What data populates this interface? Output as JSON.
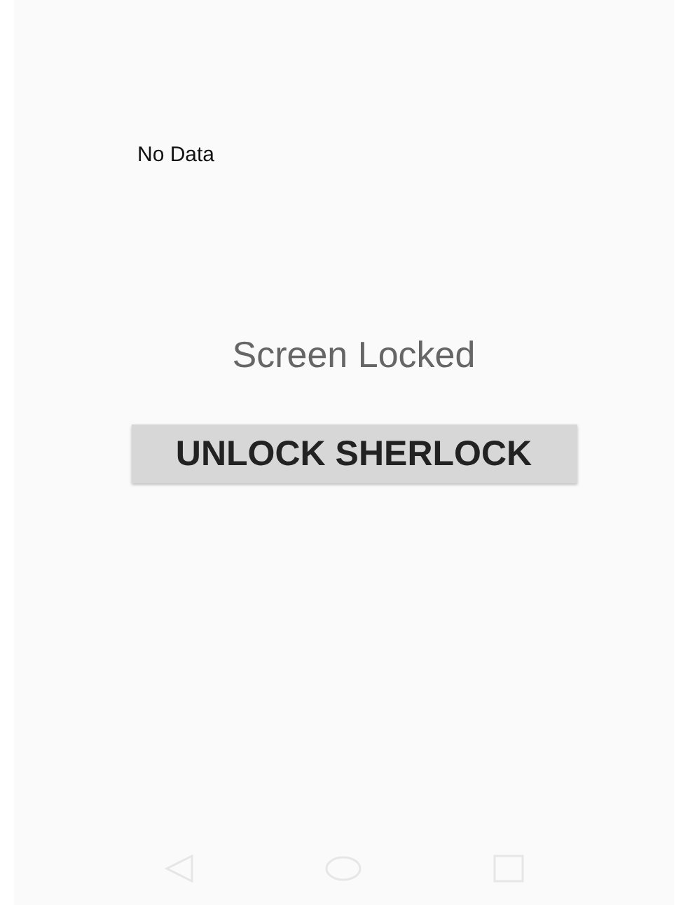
{
  "status": {
    "text": "No Data"
  },
  "lock": {
    "title": "Screen Locked",
    "button": "UNLOCK SHERLOCK"
  },
  "nav_bar": {
    "buttons": [
      {
        "kind": "back"
      },
      {
        "kind": "home"
      },
      {
        "kind": "recents"
      }
    ]
  }
}
